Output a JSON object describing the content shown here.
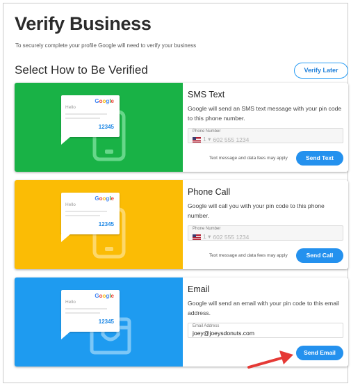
{
  "page": {
    "title": "Verify Business",
    "subtitle": "To securely complete your profile Google will need to verify your business",
    "section_title": "Select How to Be Verified",
    "verify_later_label": "Verify Later"
  },
  "bubble": {
    "brand": [
      "G",
      "o",
      "o",
      "g",
      "l",
      "e"
    ],
    "greeting": "Hello",
    "code": "12345"
  },
  "cards": [
    {
      "title": "SMS Text",
      "description": "Google will send an SMS text message with your pin code to this phone number.",
      "field_label": "Phone Number",
      "field_prefix": "1 ▾",
      "field_value": "602 555 1234",
      "note": "Text message and data fees may apply",
      "button_label": "Send Text",
      "color": "#19b246",
      "device_color": "#67d78a"
    },
    {
      "title": "Phone Call",
      "description": "Google will call you with your pin code to this phone number.",
      "field_label": "Phone Number",
      "field_prefix": "1 ▾",
      "field_value": "602 555 1234",
      "note": "Text message and data fees may apply",
      "button_label": "Send Call",
      "color": "#fbbc05",
      "device_color": "#fdd86a"
    },
    {
      "title": "Email",
      "description": "Google will send an email with your pin code to this email address.",
      "field_label": "Email Address",
      "field_value": "joey@joeysdonuts.com",
      "button_label": "Send Email",
      "color": "#1e9bf0",
      "device_color": "#7cc7f7"
    }
  ],
  "annotation": {
    "arrow_color": "#e53935"
  }
}
